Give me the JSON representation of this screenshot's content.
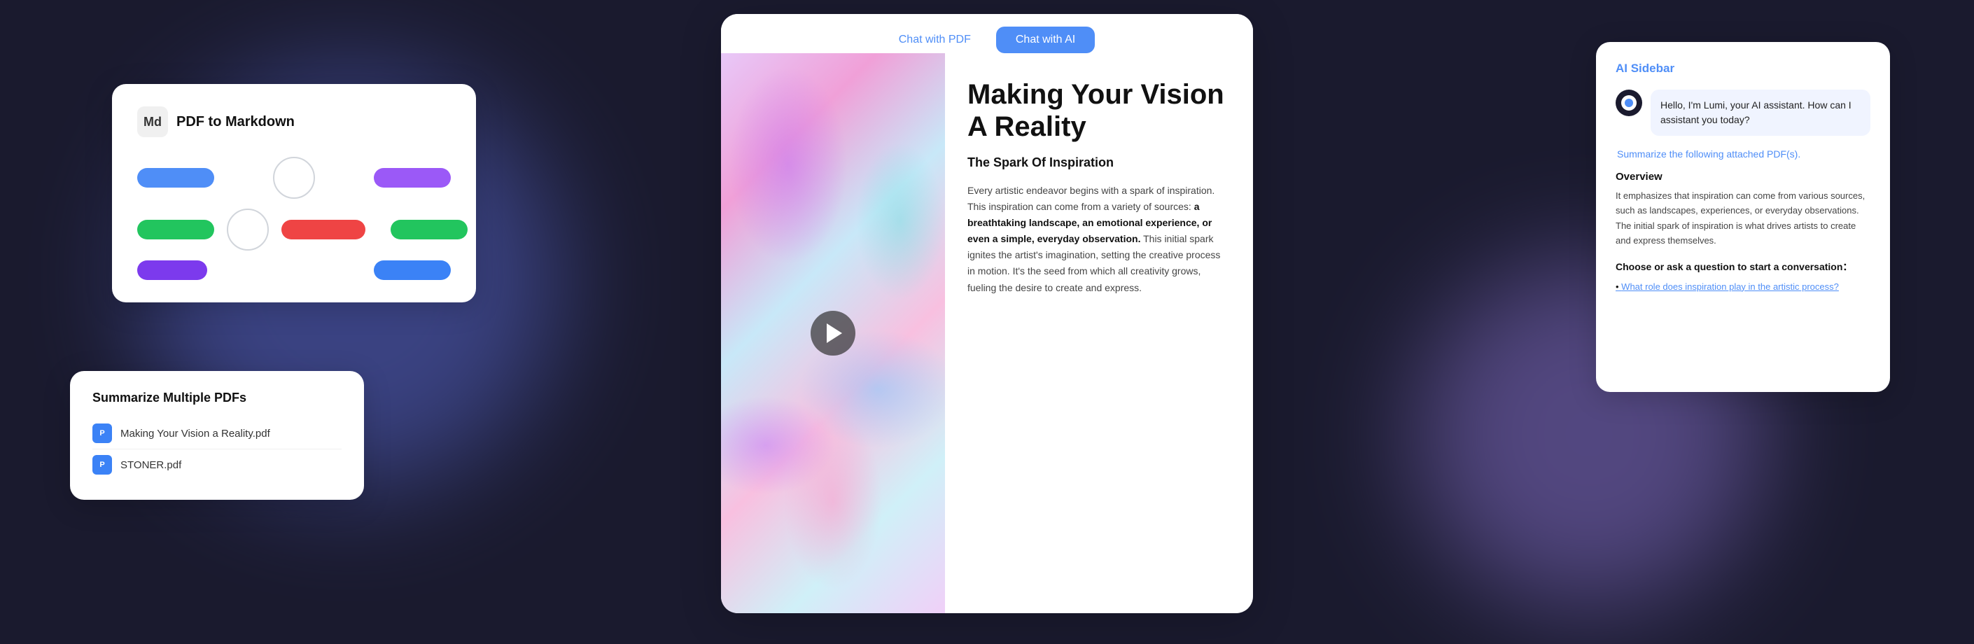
{
  "background": {
    "color": "#1a1a2e"
  },
  "tabs": {
    "chat_pdf_label": "Chat with PDF",
    "chat_ai_label": "Chat with AI"
  },
  "card_markdown": {
    "title": "PDF to Markdown",
    "icon_label": "Md"
  },
  "card_summarize": {
    "title": "Summarize Multiple PDFs",
    "files": [
      {
        "name": "Making Your Vision a Reality.pdf"
      },
      {
        "name": "STONER.pdf"
      }
    ]
  },
  "pdf_content": {
    "heading": "Making Your Vision A Reality",
    "section_title": "The Spark Of Inspiration",
    "body": "Every artistic endeavor begins with a spark of inspiration. This inspiration can come from a variety of sources:",
    "body_highlighted": "a breathtaking landscape, an emotional experience, or even a simple, everyday observation.",
    "body_rest": "This initial spark ignites the artist's imagination, setting the creative process in motion. It's the seed from which all creativity grows, fueling the desire to create and express."
  },
  "ai_sidebar": {
    "title": "AI Sidebar",
    "lumi_greeting": "Hello, I'm Lumi, your AI assistant. How can I assistant you today?",
    "user_message": "Summarize the following attached PDF(s).",
    "overview_title": "Overview",
    "overview_body": "It emphasizes that inspiration can come from various sources, such as landscapes, experiences, or everyday observations. The initial spark of inspiration is what drives artists to create and express themselves.",
    "cta_label": "Choose or ask a question to start a conversation：",
    "suggestion_link": "What role does inspiration play in the artistic process?"
  },
  "icons": {
    "pdf_icon": "P",
    "play_btn": "▶"
  }
}
